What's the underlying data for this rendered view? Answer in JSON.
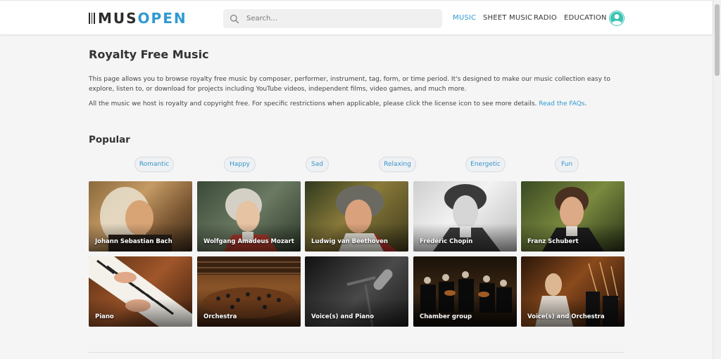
{
  "header": {
    "logo_dark": "MUS",
    "logo_blue": "OPEN",
    "search_placeholder": "Search...",
    "nav": [
      {
        "label": "MUSIC",
        "active": true
      },
      {
        "label": "SHEET MUSIC",
        "active": false
      },
      {
        "label": "RADIO",
        "active": false
      },
      {
        "label": "EDUCATION",
        "active": false
      }
    ]
  },
  "main": {
    "title": "Royalty Free Music",
    "intro": "This page allows you to browse royalty free music by composer, performer, instrument, tag, form, or time period. It's designed to make our music collection easy to explore, listen to, or download for projects including YouTube videos, independent films, video games, and much more.",
    "license_text": "All the music we host is royalty and copyright free. For specific restrictions when applicable, please click the license icon to see more details.",
    "faq_link": "Read the FAQs",
    "popular_heading": "Popular",
    "moods": [
      "Romantic",
      "Happy",
      "Sad",
      "Relaxing",
      "Energetic",
      "Fun"
    ],
    "composers": [
      "Johann Sebastian Bach",
      "Wolfgang Amadeus Mozart",
      "Ludwig van Beethoven",
      "Frédéric Chopin",
      "Franz Schubert"
    ],
    "ensembles": [
      "Piano",
      "Orchestra",
      "Voice(s) and Piano",
      "Chamber group",
      "Voice(s) and Orchestra"
    ]
  },
  "colors": {
    "accent": "#2f9ad0",
    "avatar": "#3cc4b4"
  }
}
